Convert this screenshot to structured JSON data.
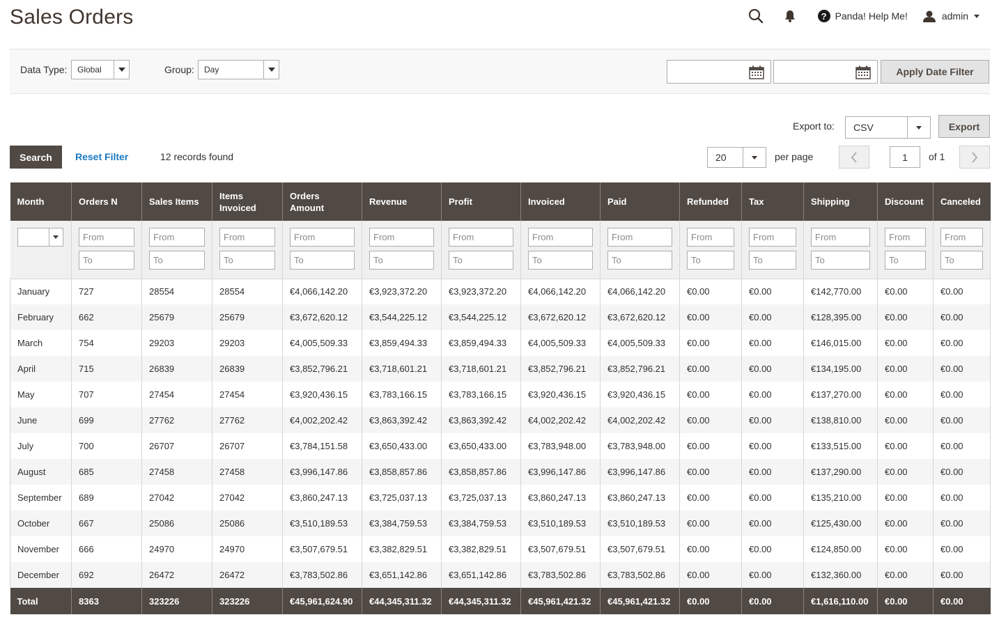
{
  "page": {
    "title": "Sales Orders"
  },
  "header": {
    "help_label": "Panda! Help Me!",
    "user_label": "admin",
    "icons": [
      "search-icon",
      "bell-icon",
      "help-icon",
      "user-icon",
      "chevron-down-icon"
    ]
  },
  "filter_bar": {
    "data_type_label": "Data Type:",
    "data_type_value": "Global",
    "group_label": "Group:",
    "group_value": "Day",
    "date_from": "",
    "date_to": "",
    "apply_label": "Apply Date Filter"
  },
  "export": {
    "label": "Export to:",
    "format": "CSV",
    "button": "Export"
  },
  "toolbar": {
    "search_label": "Search",
    "reset_label": "Reset Filter",
    "records": "12 records found",
    "per_page_value": "20",
    "per_page_label": "per page",
    "page": "1",
    "of_label": "of 1"
  },
  "grid": {
    "columns": [
      "Month",
      "Orders N",
      "Sales Items",
      "Items Invoiced",
      "Orders Amount",
      "Revenue",
      "Profit",
      "Invoiced",
      "Paid",
      "Refunded",
      "Tax",
      "Shipping",
      "Discount",
      "Canceled"
    ],
    "from_placeholder": "From",
    "to_placeholder": "To",
    "rows": [
      [
        "January",
        "727",
        "28554",
        "28554",
        "€4,066,142.20",
        "€3,923,372.20",
        "€3,923,372.20",
        "€4,066,142.20",
        "€4,066,142.20",
        "€0.00",
        "€0.00",
        "€142,770.00",
        "€0.00",
        "€0.00"
      ],
      [
        "February",
        "662",
        "25679",
        "25679",
        "€3,672,620.12",
        "€3,544,225.12",
        "€3,544,225.12",
        "€3,672,620.12",
        "€3,672,620.12",
        "€0.00",
        "€0.00",
        "€128,395.00",
        "€0.00",
        "€0.00"
      ],
      [
        "March",
        "754",
        "29203",
        "29203",
        "€4,005,509.33",
        "€3,859,494.33",
        "€3,859,494.33",
        "€4,005,509.33",
        "€4,005,509.33",
        "€0.00",
        "€0.00",
        "€146,015.00",
        "€0.00",
        "€0.00"
      ],
      [
        "April",
        "715",
        "26839",
        "26839",
        "€3,852,796.21",
        "€3,718,601.21",
        "€3,718,601.21",
        "€3,852,796.21",
        "€3,852,796.21",
        "€0.00",
        "€0.00",
        "€134,195.00",
        "€0.00",
        "€0.00"
      ],
      [
        "May",
        "707",
        "27454",
        "27454",
        "€3,920,436.15",
        "€3,783,166.15",
        "€3,783,166.15",
        "€3,920,436.15",
        "€3,920,436.15",
        "€0.00",
        "€0.00",
        "€137,270.00",
        "€0.00",
        "€0.00"
      ],
      [
        "June",
        "699",
        "27762",
        "27762",
        "€4,002,202.42",
        "€3,863,392.42",
        "€3,863,392.42",
        "€4,002,202.42",
        "€4,002,202.42",
        "€0.00",
        "€0.00",
        "€138,810.00",
        "€0.00",
        "€0.00"
      ],
      [
        "July",
        "700",
        "26707",
        "26707",
        "€3,784,151.58",
        "€3,650,433.00",
        "€3,650,433.00",
        "€3,783,948.00",
        "€3,783,948.00",
        "€0.00",
        "€0.00",
        "€133,515.00",
        "€0.00",
        "€0.00"
      ],
      [
        "August",
        "685",
        "27458",
        "27458",
        "€3,996,147.86",
        "€3,858,857.86",
        "€3,858,857.86",
        "€3,996,147.86",
        "€3,996,147.86",
        "€0.00",
        "€0.00",
        "€137,290.00",
        "€0.00",
        "€0.00"
      ],
      [
        "September",
        "689",
        "27042",
        "27042",
        "€3,860,247.13",
        "€3,725,037.13",
        "€3,725,037.13",
        "€3,860,247.13",
        "€3,860,247.13",
        "€0.00",
        "€0.00",
        "€135,210.00",
        "€0.00",
        "€0.00"
      ],
      [
        "October",
        "667",
        "25086",
        "25086",
        "€3,510,189.53",
        "€3,384,759.53",
        "€3,384,759.53",
        "€3,510,189.53",
        "€3,510,189.53",
        "€0.00",
        "€0.00",
        "€125,430.00",
        "€0.00",
        "€0.00"
      ],
      [
        "November",
        "666",
        "24970",
        "24970",
        "€3,507,679.51",
        "€3,382,829.51",
        "€3,382,829.51",
        "€3,507,679.51",
        "€3,507,679.51",
        "€0.00",
        "€0.00",
        "€124,850.00",
        "€0.00",
        "€0.00"
      ],
      [
        "December",
        "692",
        "26472",
        "26472",
        "€3,783,502.86",
        "€3,651,142.86",
        "€3,651,142.86",
        "€3,783,502.86",
        "€3,783,502.86",
        "€0.00",
        "€0.00",
        "€132,360.00",
        "€0.00",
        "€0.00"
      ]
    ],
    "totals": [
      "Total",
      "8363",
      "323226",
      "323226",
      "€45,961,624.90",
      "€44,345,311.32",
      "€44,345,311.32",
      "€45,961,421.32",
      "€45,961,421.32",
      "€0.00",
      "€0.00",
      "€1,616,110.00",
      "€0.00",
      "€0.00"
    ]
  }
}
